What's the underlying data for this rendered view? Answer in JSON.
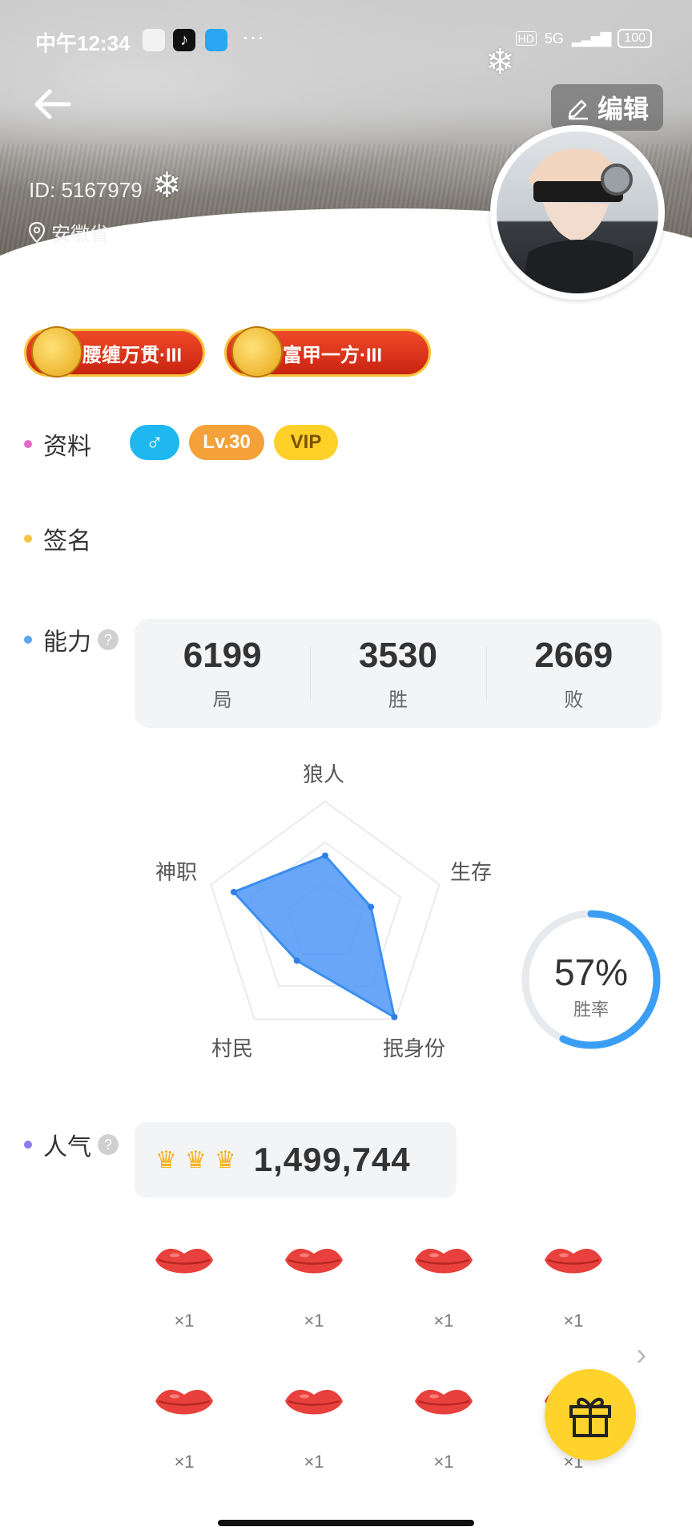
{
  "status_bar": {
    "time": "中午12:34",
    "more": "···",
    "network": "5G",
    "hd": "HD",
    "battery": "100"
  },
  "header": {
    "edit_label": "编辑",
    "user_id": "ID: 5167979",
    "location": "安徽省"
  },
  "badges": [
    {
      "label": "腰缠万贯·III"
    },
    {
      "label": "富甲一方·III"
    }
  ],
  "profile": {
    "info_label": "资料",
    "gender_symbol": "♂",
    "level": "Lv.30",
    "vip": "VIP",
    "signature_label": "签名"
  },
  "ability": {
    "label": "能力",
    "help": "?",
    "stats": [
      {
        "value": "6199",
        "label": "局"
      },
      {
        "value": "3530",
        "label": "胜"
      },
      {
        "value": "2669",
        "label": "败"
      }
    ]
  },
  "radar": {
    "axes": [
      "狼人",
      "生存",
      "抿身份",
      "村民",
      "神职"
    ],
    "values": [
      0.55,
      0.4,
      0.98,
      0.4,
      0.8
    ]
  },
  "win_rate": {
    "value": "57%",
    "label": "胜率",
    "fraction": 0.57
  },
  "popularity": {
    "label": "人气",
    "help": "?",
    "crowns": 3,
    "value": "1,499,744"
  },
  "gifts": [
    {
      "count": "×1"
    },
    {
      "count": "×1"
    },
    {
      "count": "×1"
    },
    {
      "count": "×1"
    },
    {
      "count": "×1"
    },
    {
      "count": "×1"
    },
    {
      "count": "×1"
    },
    {
      "count": "×1"
    }
  ],
  "colors": {
    "info_dot": "#e46ac8",
    "sign_dot": "#f5c542",
    "ability_dot": "#5aa6f0",
    "pop_dot": "#8c7cf0",
    "gender_pill": "#1fb7f0",
    "level_pill": "#f5a13a",
    "vip_pill": "#ffd028",
    "radar_fill": "#4f97f7",
    "ring": "#3b9ef5"
  }
}
